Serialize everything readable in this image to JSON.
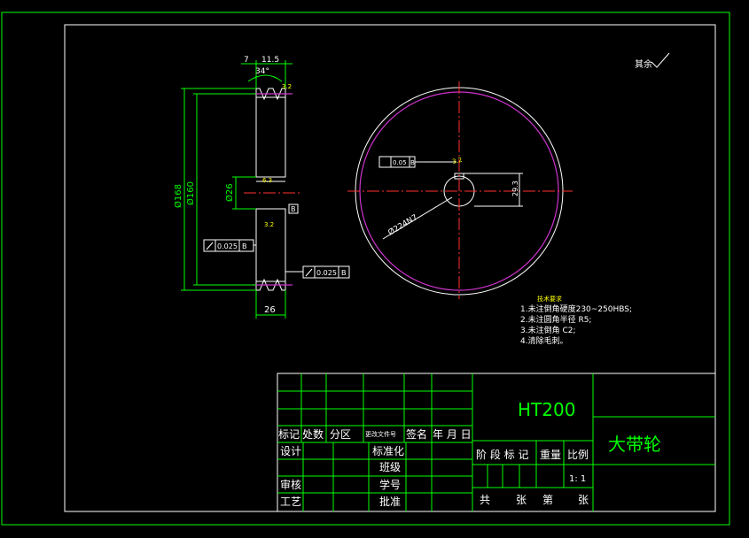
{
  "drawing": {
    "section_dims": {
      "groove_top": "7",
      "groove_pitch": "11.5",
      "groove_angle": "34°",
      "dia_outer": "Ø168",
      "dia_pitch": "Ø160",
      "bore_dia": "Ø26",
      "width": "26",
      "runout_left": "0.025",
      "runout_left_datum": "B",
      "runout_right": "0.025",
      "runout_right_datum": "B",
      "datum_letter": "B",
      "finish_top": "3.2",
      "finish_mid": "6.3",
      "finish_small": "3.2"
    },
    "front_view": {
      "sym_value": "0.05",
      "sym_datum": "B",
      "keyway_depth": "29.3",
      "diag_label": "Ø224N7"
    },
    "general_finish": "其余",
    "tech_req": {
      "title": "技术要求",
      "items": [
        "1.未注倒角硬度230~250HBS;",
        "2.未注圆角半径 R5;",
        "3.未注倒角 C2;",
        "4.清除毛刺。"
      ]
    }
  },
  "title_block": {
    "material": "HT200",
    "part_name": "大带轮",
    "revision_headers": [
      "标记",
      "处数",
      "分区",
      "更改文件号",
      "签名",
      "年 月 日"
    ],
    "labels": {
      "design": "设计",
      "standardize": "标准化",
      "class": "班级",
      "review": "审核",
      "student_no": "学号",
      "process": "工艺",
      "approve": "批准"
    },
    "stage_mark": "阶 段 标 记",
    "weight": "重量",
    "scale_label": "比例",
    "scale_value": "1: 1",
    "sheet_total": "共",
    "sheet_unit": "张",
    "sheet_no": "第",
    "sheet_unit2": "张"
  }
}
